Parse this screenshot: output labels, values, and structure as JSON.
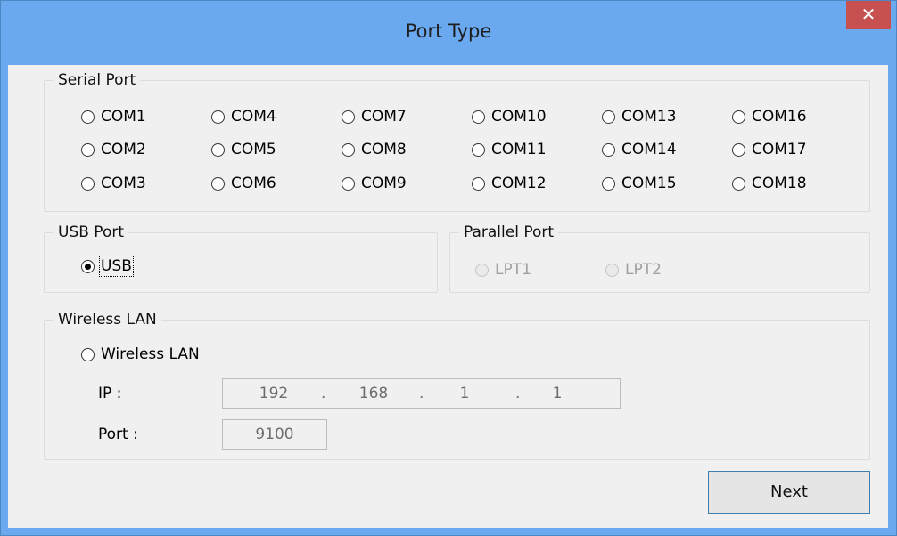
{
  "window": {
    "title": "Port Type",
    "close_label": "✕"
  },
  "serial_port": {
    "title": "Serial Port",
    "options": [
      "COM1",
      "COM4",
      "COM7",
      "COM10",
      "COM13",
      "COM16",
      "COM2",
      "COM5",
      "COM8",
      "COM11",
      "COM14",
      "COM17",
      "COM3",
      "COM6",
      "COM9",
      "COM12",
      "COM15",
      "COM18"
    ]
  },
  "usb_port": {
    "title": "USB Port",
    "option": "USB",
    "selected": true
  },
  "parallel_port": {
    "title": "Parallel Port",
    "options": [
      "LPT1",
      "LPT2"
    ],
    "enabled": false
  },
  "wireless_lan": {
    "title": "Wireless LAN",
    "option": "Wireless LAN",
    "ip_label": "IP :",
    "ip": [
      "192",
      "168",
      "1",
      "1"
    ],
    "ip_separator": ".",
    "port_label": "Port :",
    "port": "9100"
  },
  "buttons": {
    "next": "Next"
  },
  "colors": {
    "titlebar": "#6aa8f0",
    "close": "#c75050",
    "client": "#f0f0f0"
  }
}
